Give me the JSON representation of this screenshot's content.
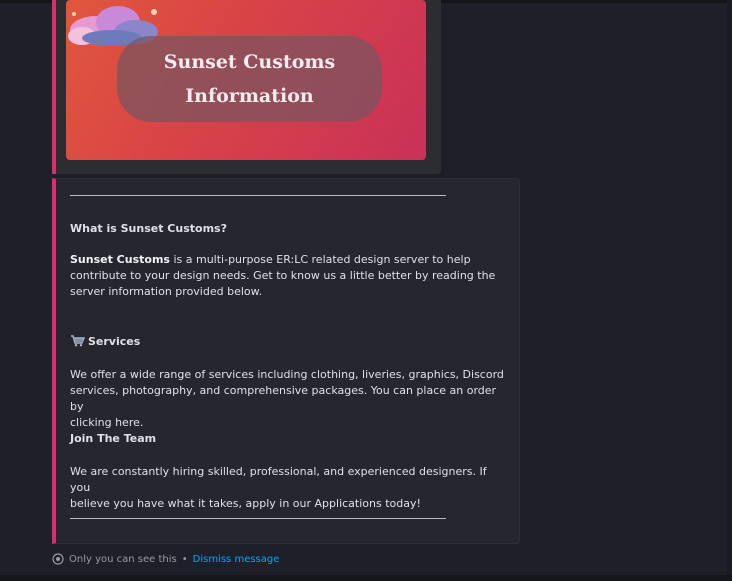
{
  "banner": {
    "title_line1": "Sunset Customs",
    "title_line2": "Information"
  },
  "info": {
    "q_heading": "What is Sunset Customs?",
    "about_bold": "Sunset Customs",
    "about_text_line1": " is a multi-purpose ER:LC related design server to help",
    "about_text_line2": "contribute to your design needs. Get to know us a little better by reading the",
    "about_text_line3": "server information provided below.",
    "services_heading": "Services",
    "services_line1": "We offer a wide range of services including clothing, liveries, graphics, Discord",
    "services_line2": "services, photography, and comprehensive packages. You can place an order by",
    "services_line3": "clicking here.",
    "join_heading": "Join The Team",
    "join_line1": "We are constantly hiring skilled, professional, and experienced designers. If you",
    "join_line2": "believe you have what it takes, apply in our Applications today!"
  },
  "footer": {
    "ephemeral_text": "Only you can see this",
    "separator": "•",
    "dismiss_label": "Dismiss message"
  },
  "icons": {
    "services": "shopping-cart-icon",
    "footer": "eye-icon"
  },
  "colors": {
    "accent_border": "#d4306b",
    "link": "#00a8fc",
    "banner_gradient_start": "#e0573d",
    "banner_gradient_end": "#c93158"
  }
}
